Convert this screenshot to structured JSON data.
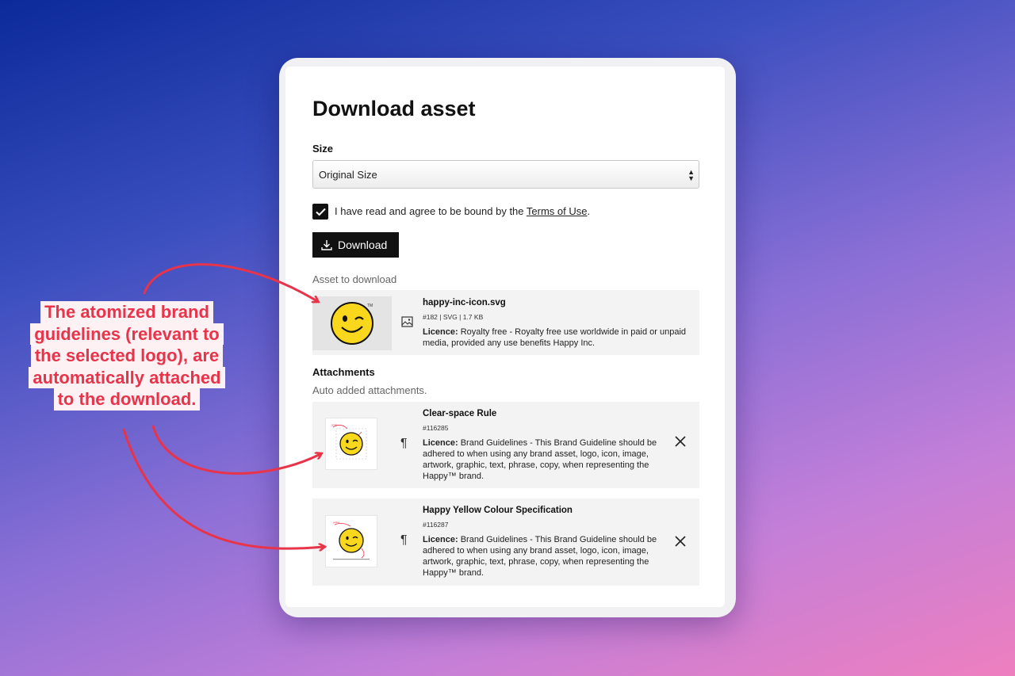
{
  "dialog": {
    "title": "Download asset",
    "size_label": "Size",
    "size_value": "Original Size",
    "terms_prefix": "I have read and agree to be bound by the ",
    "terms_link": "Terms of Use",
    "terms_suffix": ".",
    "download_label": "Download",
    "asset_section_label": "Asset to download"
  },
  "asset": {
    "filename": "happy-inc-icon.svg",
    "meta": "#182 | SVG | 1.7 KB",
    "licence_label": "Licence:",
    "licence_text": " Royalty free - Royalty free use worldwide in paid or unpaid media, provided any use benefits Happy Inc.",
    "type_icon": "image-icon"
  },
  "attachments": {
    "heading": "Attachments",
    "subheading": "Auto added attachments.",
    "items": [
      {
        "title": "Clear-space Rule",
        "id": "#116285",
        "licence_label": "Licence:",
        "licence_text": " Brand Guidelines - This Brand Guideline should be adhered to when using any brand asset, logo, icon, image, artwork, graphic, text, phrase, copy, when representing the Happy™ brand.",
        "type_icon": "pilcrow-icon"
      },
      {
        "title": "Happy Yellow Colour Specification",
        "id": "#116287",
        "licence_label": "Licence:",
        "licence_text": " Brand Guidelines - This Brand Guideline should be adhered to when using any brand asset, logo, icon, image, artwork, graphic, text, phrase, copy, when representing the Happy™ brand.",
        "type_icon": "pilcrow-icon"
      }
    ]
  },
  "callout": {
    "lines": [
      "The atomized brand",
      "guidelines (relevant to",
      "the selected logo), are",
      "automatically attached",
      "to the download."
    ]
  },
  "colors": {
    "accent_red": "#e8344a",
    "smiley_yellow": "#f9d71c",
    "button_black": "#111111"
  }
}
